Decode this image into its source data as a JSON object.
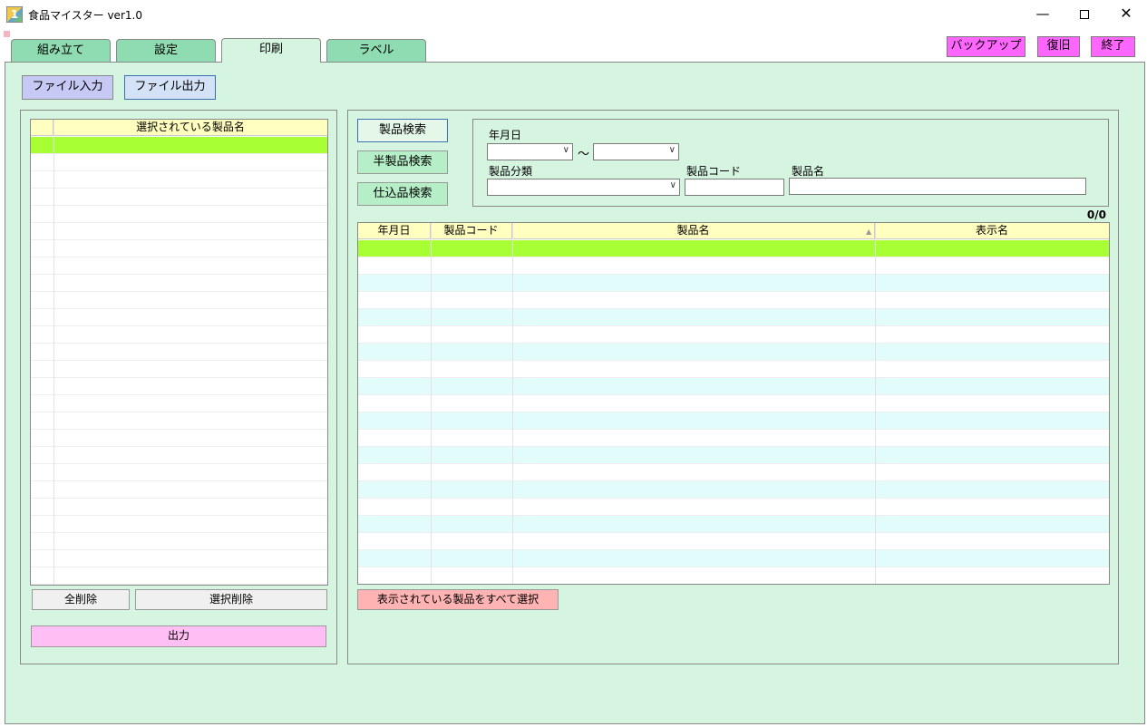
{
  "window": {
    "title": "食品マイスター ver1.0",
    "app_icon_text": "1"
  },
  "tabs": [
    {
      "label": "組み立て"
    },
    {
      "label": "設定"
    },
    {
      "label": "印刷"
    },
    {
      "label": "ラベル"
    }
  ],
  "active_tab": "印刷",
  "top_buttons": {
    "backup": "バックアップ",
    "restore": "復旧",
    "exit": "終了"
  },
  "file": {
    "input": "ファイル入力",
    "output": "ファイル出力"
  },
  "left_panel": {
    "grid_header": "選択されている製品名",
    "delete_all": "全削除",
    "delete_selected": "選択削除",
    "output": "出力"
  },
  "search": {
    "product_search": "製品検索",
    "semi_search": "半製品検索",
    "stock_search": "仕込品検索",
    "date_label": "年月日",
    "range_sep": "～",
    "category_label": "製品分類",
    "code_label": "製品コード",
    "name_label": "製品名"
  },
  "result": {
    "count": "0/0",
    "columns": [
      "年月日",
      "製品コード",
      "製品名",
      "表示名"
    ],
    "select_all": "表示されている製品をすべて選択"
  },
  "colors": {
    "tab": "#8fdcb2",
    "panel": "#d6f5e1",
    "selected_row": "#a8ff33",
    "grid_header": "#ffffc0",
    "alt_row": "#e2fbfb",
    "magenta_button": "#ff66ff"
  }
}
